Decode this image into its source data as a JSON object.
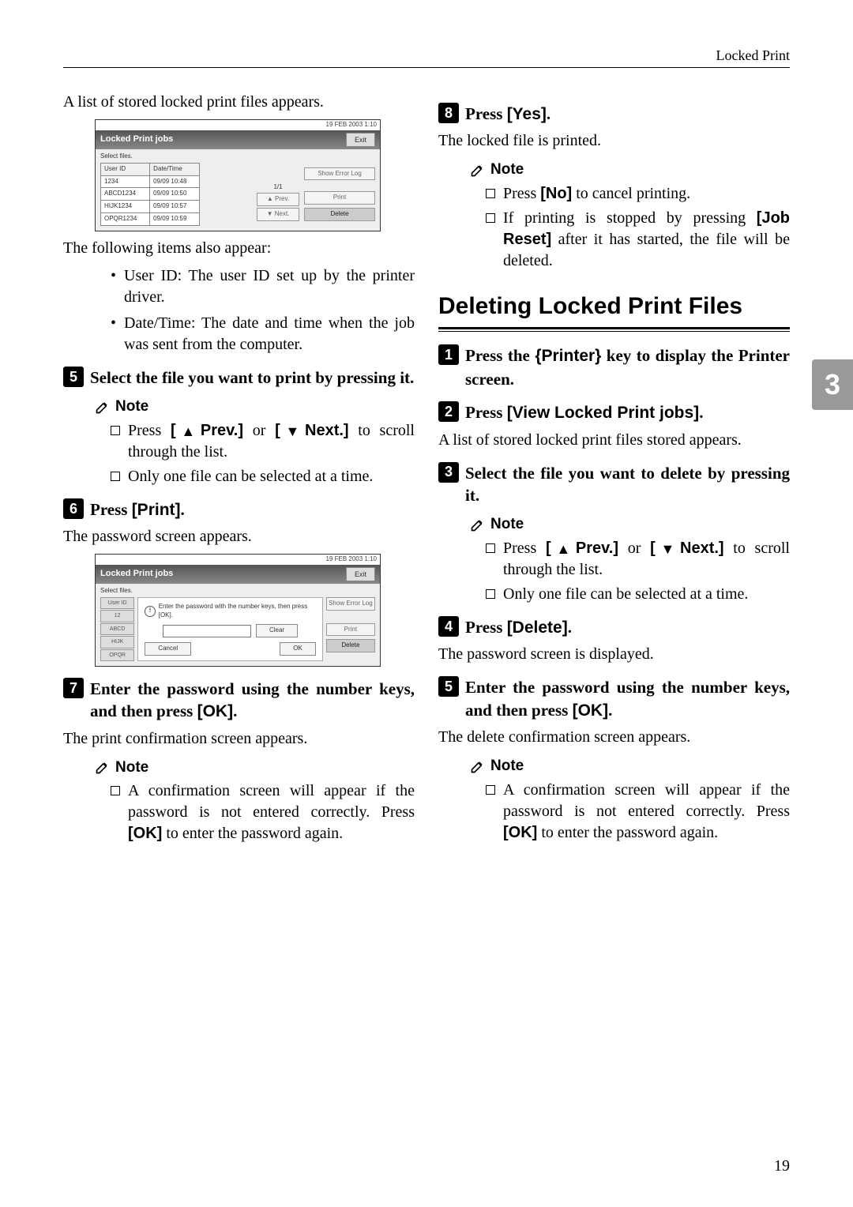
{
  "header": {
    "running_head": "Locked Print"
  },
  "side_tab": "3",
  "page_number": "19",
  "left": {
    "intro": "A list of stored locked print files appears.",
    "shot1": {
      "clock": "19 FEB  2003  1:10",
      "title": "Locked Print jobs",
      "exit": "Exit",
      "select_files": "Select files.",
      "col_user": "User ID",
      "col_date": "Date/Time",
      "rows": [
        {
          "user": "1234",
          "date": "09/09 10:48"
        },
        {
          "user": "ABCD1234",
          "date": "09/09 10:50"
        },
        {
          "user": "HIJK1234",
          "date": "09/09 10:57"
        },
        {
          "user": "OPQR1234",
          "date": "09/09 10:59"
        }
      ],
      "page_ind": "1/1",
      "show_err": "Show Error Log",
      "print": "Print",
      "delete": "Delete",
      "prev": "▲ Prev.",
      "next": "▼ Next."
    },
    "after_shot1": "The following items also appear:",
    "items": [
      "User ID: The user ID set up by the printer driver.",
      "Date/Time: The date and time when the job was sent from the computer."
    ],
    "step5": "Select the file you want to print by pressing it.",
    "note_label": "Note",
    "note5": [
      "Press [▲Prev.] or [▼Next.] to scroll through the list.",
      "Only one file can be selected at a time."
    ],
    "step6": "Press [Print].",
    "after6": "The password screen appears.",
    "shot2": {
      "clock": "19 FEB  2003  1:10",
      "title": "Locked Print jobs",
      "exit": "Exit",
      "select_files": "Select files.",
      "side": [
        "User ID",
        "12",
        "ABCD",
        "HIJK",
        "OPQR"
      ],
      "msg": "Enter the password with the number keys, then press [OK].",
      "clear": "Clear",
      "cancel": "Cancel",
      "ok": "OK",
      "show_err": "Show Error Log",
      "print": "Print",
      "delete": "Delete"
    },
    "step7": "Enter the password using the number keys, and then press [OK].",
    "after7": "The print confirmation screen appears.",
    "note7": [
      "A confirmation screen will appear if the password is not entered correctly. Press [OK] to enter the password again."
    ]
  },
  "right": {
    "step8": "Press [Yes].",
    "after8": "The locked file is printed.",
    "note8": [
      "Press [No] to cancel printing.",
      "If printing is stopped by pressing [Job Reset] after it has started, the file will be deleted."
    ],
    "h2": "Deleting Locked Print Files",
    "d_step1": "Press the {Printer} key to display the Printer screen.",
    "d_step2": "Press [View Locked Print jobs].",
    "d_after2": "A list of stored locked print files stored appears.",
    "d_step3": "Select the file you want to delete by pressing it.",
    "d_note3": [
      "Press [▲Prev.] or [▼Next.] to scroll through the list.",
      "Only one file can be selected at a time."
    ],
    "d_step4": "Press [Delete].",
    "d_after4": "The password screen is displayed.",
    "d_step5": "Enter the password using the number keys, and then press [OK].",
    "d_after5": "The delete confirmation screen appears.",
    "d_note5": [
      "A confirmation screen will appear if the password is not entered correctly. Press [OK] to enter the password again."
    ],
    "note_label": "Note"
  }
}
